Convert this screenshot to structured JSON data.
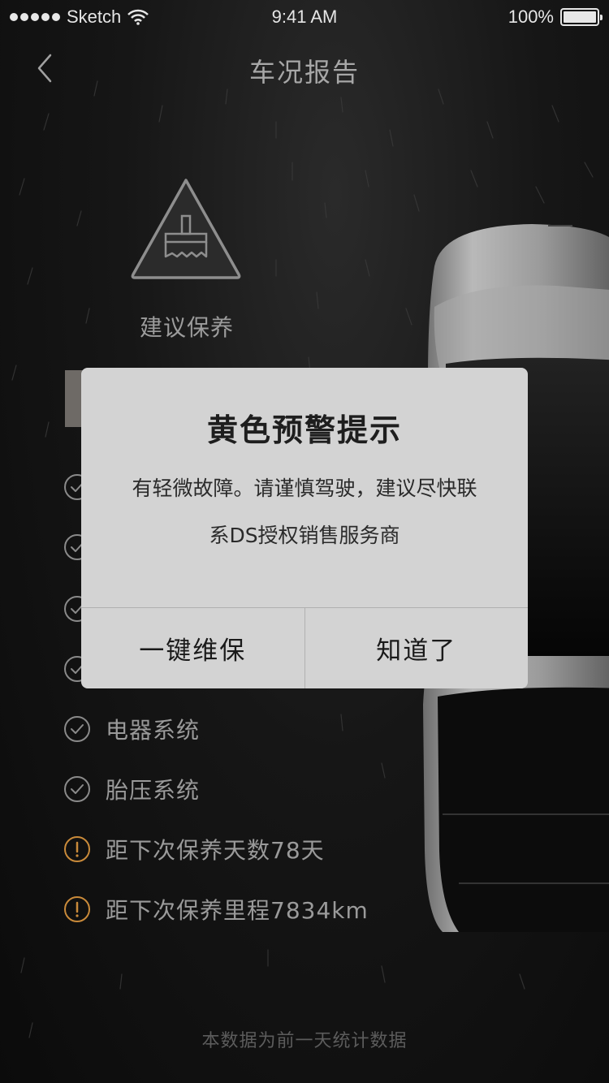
{
  "status_bar": {
    "carrier": "Sketch",
    "time": "9:41 AM",
    "battery_percent": "100%",
    "wifi_icon": "wifi-icon",
    "battery_icon": "battery-icon"
  },
  "nav": {
    "title": "车况报告",
    "back_icon": "chevron-left-icon"
  },
  "status_card": {
    "icon": "warning-brush-icon",
    "label": "建议保养"
  },
  "checklist": [
    {
      "icon": "check-circle-icon",
      "label": "",
      "status": "ok"
    },
    {
      "icon": "check-circle-icon",
      "label": "",
      "status": "ok"
    },
    {
      "icon": "check-circle-icon",
      "label": "",
      "status": "ok"
    },
    {
      "icon": "check-circle-icon",
      "label": "",
      "status": "ok"
    },
    {
      "icon": "check-circle-icon",
      "label": "电器系统",
      "status": "ok"
    },
    {
      "icon": "check-circle-icon",
      "label": "胎压系统",
      "status": "ok"
    },
    {
      "icon": "alert-circle-icon",
      "label": "距下次保养天数78天",
      "status": "warn"
    },
    {
      "icon": "alert-circle-icon",
      "label": "距下次保养里程7834km",
      "status": "warn"
    }
  ],
  "footer_note": "本数据为前一天统计数据",
  "dialog": {
    "title": "黄色预警提示",
    "message_line1": "有轻微故障。请谨慎驾驶，建议尽快联",
    "message_line2": "系DS授权销售服务商",
    "primary_button": "一键维保",
    "secondary_button": "知道了"
  },
  "colors": {
    "background": "#0d0d0d",
    "warn_accent": "#c98a3a",
    "dialog_bg": "#d3d3d3",
    "muted_text": "#9a9a9a"
  }
}
